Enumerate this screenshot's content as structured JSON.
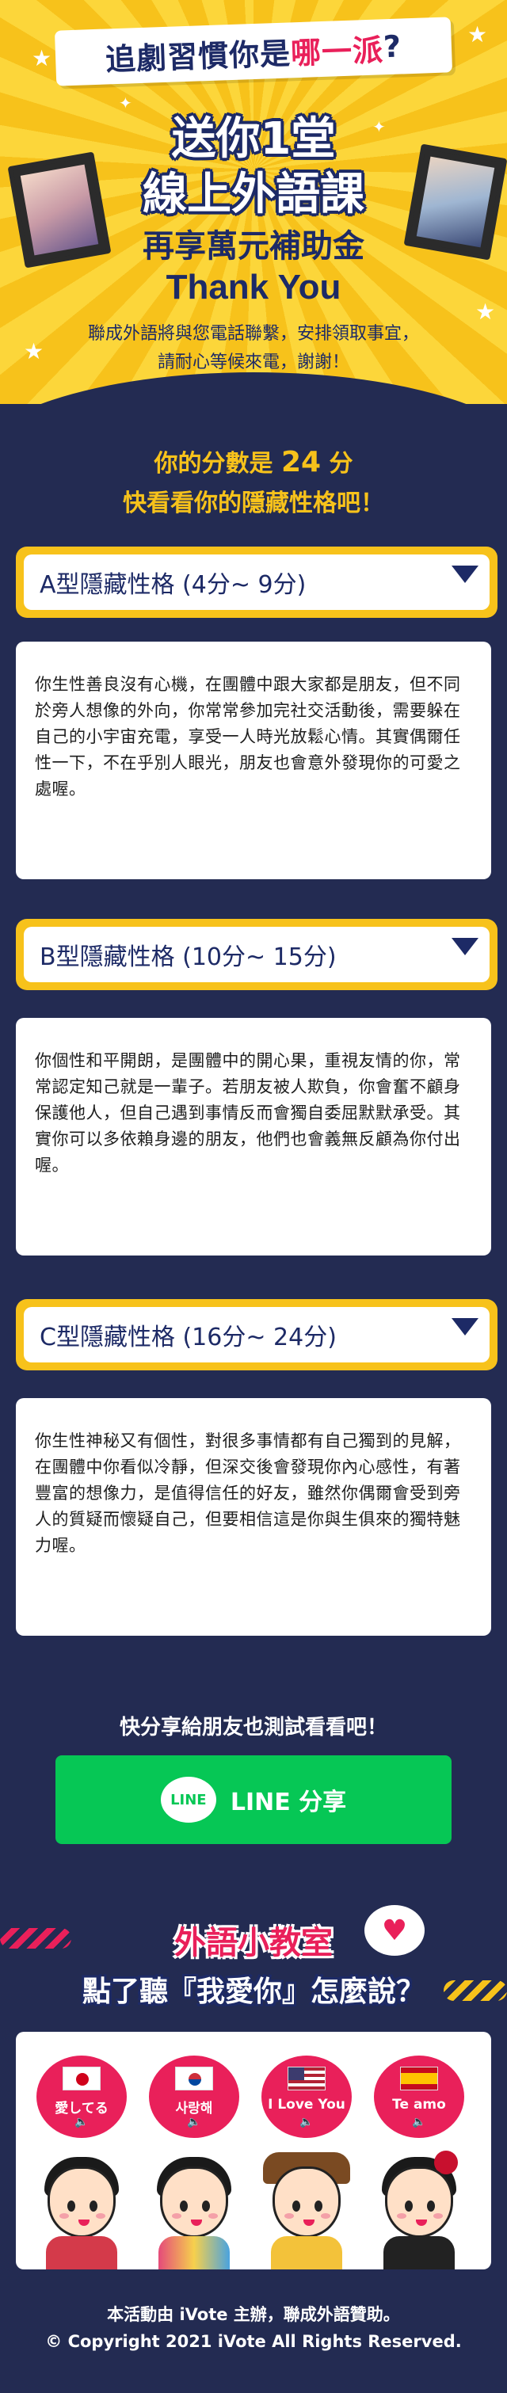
{
  "hero": {
    "banner_prefix": "追劇習慣你是",
    "banner_highlight": "哪一派",
    "banner_suffix": "?",
    "headline_1": "送你1堂",
    "headline_2": "線上外語課",
    "subheadline": "再享萬元補助金",
    "thanks": "Thank You",
    "notice_1": "聯成外語將與您電話聯繫，安排領取事宜，",
    "notice_2": "請耐心等候來電，謝謝！"
  },
  "score": {
    "prefix": "你的分數是",
    "value": "24",
    "suffix": "分",
    "subtitle": "快看看你的隱藏性格吧！"
  },
  "types": [
    {
      "title": "A型隱藏性格 (4分~ 9分)",
      "description": "你生性善良沒有心機，在團體中跟大家都是朋友，但不同於旁人想像的外向，你常常參加完社交活動後，需要躲在自己的小宇宙充電，享受一人時光放鬆心情。其實偶爾任性一下，不在乎別人眼光，朋友也會意外發現你的可愛之處喔。"
    },
    {
      "title": "B型隱藏性格 (10分~ 15分)",
      "description": "你個性和平開朗，是團體中的開心果，重視友情的你，常常認定知己就是一輩子。若朋友被人欺負，你會奮不顧身保護他人，但自己遇到事情反而會獨自委屈默默承受。其實你可以多依賴身邊的朋友，他們也會義無反顧為你付出喔。"
    },
    {
      "title": "C型隱藏性格 (16分~ 24分)",
      "description": "你生性神秘又有個性，對很多事情都有自己獨到的見解，在團體中你看似冷靜，但深交後會發現你內心感性，有著豐富的想像力，是值得信任的好友，雖然你偶爾會受到旁人的質疑而懷疑自己，但要相信這是你與生俱來的獨特魅力喔。"
    }
  ],
  "share": {
    "prompt": "快分享給朋友也測試看看吧！",
    "line_logo": "LINE",
    "button_label": "LINE 分享"
  },
  "classroom": {
    "title": "外語小教室",
    "subtitle": "點了聽『我愛你』怎麼說？",
    "heart": "♥",
    "phrases": [
      {
        "text": "愛してる",
        "flag": "japan"
      },
      {
        "text": "사랑해",
        "flag": "korea"
      },
      {
        "text": "I Love You",
        "flag": "usa"
      },
      {
        "text": "Te amo",
        "flag": "spain"
      }
    ],
    "speaker_icon": "🔈"
  },
  "footer": {
    "line_1": "本活動由 iVote 主辦，聯成外語贊助。",
    "line_2": "© Copyright 2021 iVote All Rights Reserved."
  },
  "colors": {
    "background": "#232b52",
    "accent_yellow": "#f7c21b",
    "navy": "#1d2a66",
    "pink": "#e9205a",
    "line_green": "#06c755"
  }
}
